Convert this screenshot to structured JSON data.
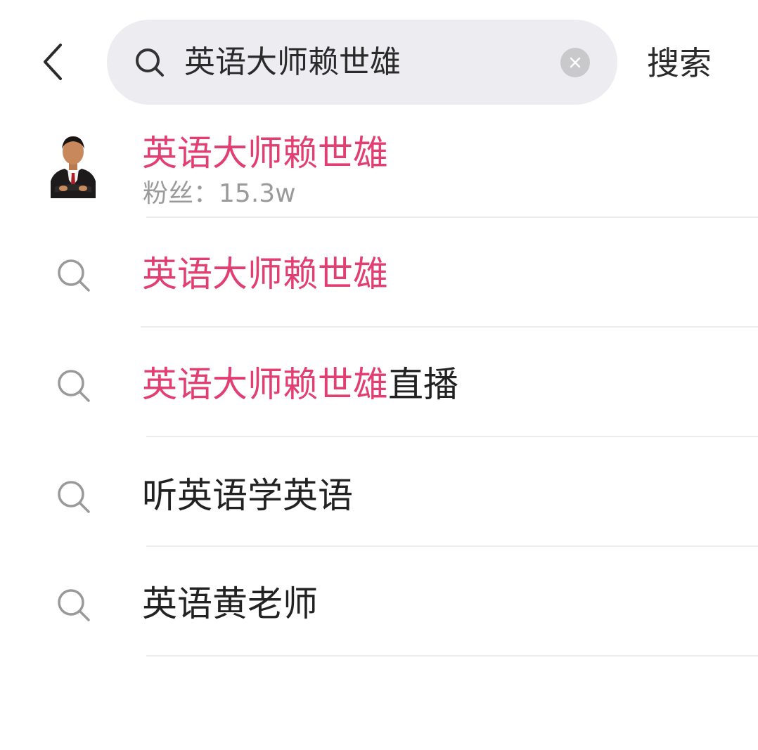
{
  "header": {
    "query": "英语大师赖世雄",
    "search_label": "搜索"
  },
  "user_result": {
    "name": "英语大师赖世雄",
    "fans_label": "粉丝：",
    "fans_count": "15.3w"
  },
  "suggestions": [
    {
      "highlight": "英语大师赖世雄",
      "rest": ""
    },
    {
      "highlight": "英语大师赖世雄",
      "rest": "直播"
    },
    {
      "highlight": "",
      "rest": "听英语学英语"
    },
    {
      "highlight": "",
      "rest": "英语黄老师"
    }
  ],
  "icons": {
    "back": "chevron-left-icon",
    "search": "search-icon",
    "clear": "clear-icon",
    "suggestion": "search-icon"
  },
  "colors": {
    "highlight": "#e23e72",
    "search_box_bg": "#ececf1",
    "text": "#222222",
    "muted": "#9a9a9a"
  }
}
